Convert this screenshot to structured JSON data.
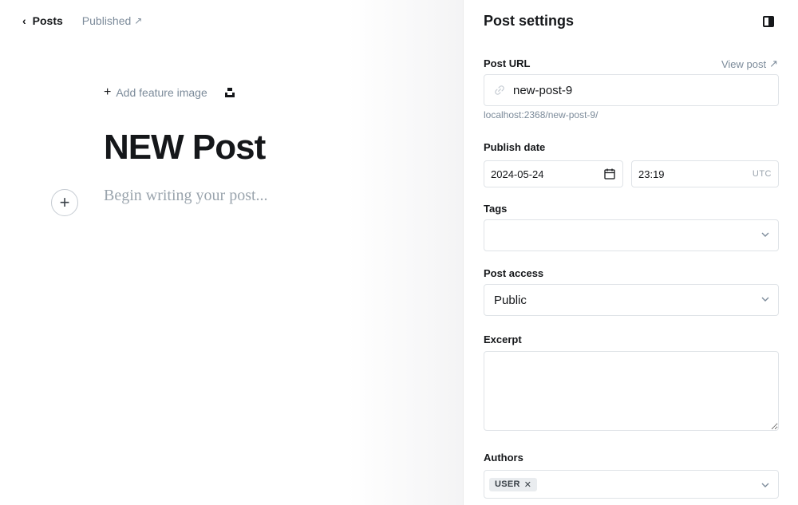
{
  "editor": {
    "back_label": "Posts",
    "status_label": "Published",
    "add_feature_image": "Add feature image",
    "title": "NEW Post",
    "body_placeholder": "Begin writing your post..."
  },
  "settings": {
    "heading": "Post settings",
    "post_url": {
      "label": "Post URL",
      "view_post": "View post",
      "value": "new-post-9",
      "hint": "localhost:2368/new-post-9/"
    },
    "publish_date": {
      "label": "Publish date",
      "date": "2024-05-24",
      "time": "23:19",
      "timezone": "UTC"
    },
    "tags": {
      "label": "Tags",
      "value": ""
    },
    "post_access": {
      "label": "Post access",
      "value": "Public"
    },
    "excerpt": {
      "label": "Excerpt",
      "value": ""
    },
    "authors": {
      "label": "Authors",
      "tokens": [
        "USER"
      ]
    }
  },
  "icons": {
    "back": "chevron-left-icon",
    "external": "arrow-up-right-icon",
    "add": "plus-icon",
    "unsplash": "unsplash-icon",
    "panel_toggle": "sidebar-toggle-icon",
    "link": "link-icon",
    "calendar": "calendar-icon",
    "dropdown": "chevron-down-icon",
    "remove": "close-icon"
  },
  "colors": {
    "text": "#15171a",
    "muted": "#7c8b9a",
    "border": "#dfe3e7"
  }
}
